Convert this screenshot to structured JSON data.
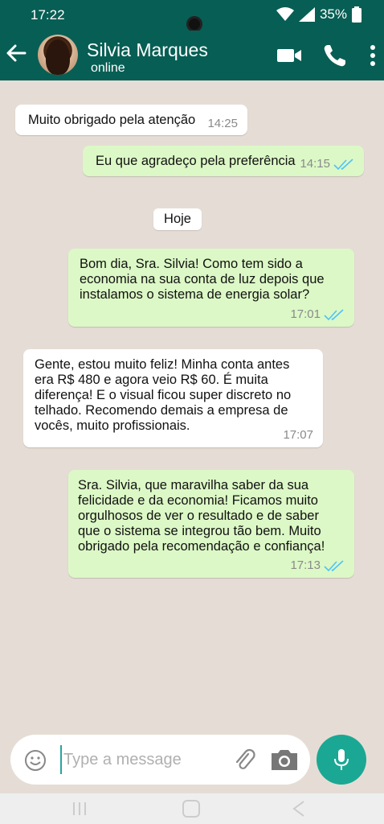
{
  "status_bar": {
    "time": "17:22",
    "battery": "35%"
  },
  "header": {
    "contact_name": "Silvia Marques",
    "contact_status": "online"
  },
  "day_divider": "Hoje",
  "messages": [
    {
      "direction": "in",
      "text": "Muito obrigado pela atenção",
      "time": "14:25"
    },
    {
      "direction": "out",
      "text": "Eu que agradeço pela preferência",
      "time": "14:15",
      "read": true
    },
    {
      "direction": "out",
      "text": "Bom dia, Sra. Silvia! Como tem sido a economia na sua conta de luz depois que instalamos o sistema de energia solar?",
      "time": "17:01",
      "read": true
    },
    {
      "direction": "in",
      "text": "Gente, estou muito feliz! Minha conta antes era R$ 480 e agora veio R$ 60. É muita diferença! E o visual ficou super discreto no telhado. Recomendo demais a empresa de vocês, muito profissionais.",
      "time": "17:07"
    },
    {
      "direction": "out",
      "text": "Sra. Silvia, que maravilha saber da sua felicidade e da economia! Ficamos muito orgulhosos de ver o resultado e de saber que o sistema se integrou tão bem. Muito obrigado pela recomendação e confiança!",
      "time": "17:13",
      "read": true
    }
  ],
  "composer": {
    "placeholder": "Type a message",
    "value": ""
  },
  "colors": {
    "header": "#075e54",
    "outgoing": "#dcf8c6",
    "incoming": "#ffffff",
    "background": "#e5ddd5",
    "mic": "#1aa894",
    "ticks": "#4fc3f7"
  }
}
